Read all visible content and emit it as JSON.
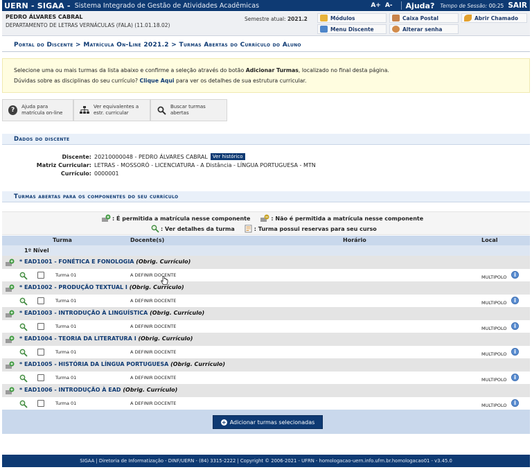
{
  "topbar": {
    "brand": "UERN - SIGAA -",
    "system": "Sistema Integrado de Gestão de Atividades Acadêmicas",
    "font_up": "A+",
    "font_down": "A-",
    "help": "Ajuda?",
    "session_label": "Tempo de Sessão:",
    "session_time": "00:25",
    "logout": "SAIR"
  },
  "user": {
    "name": "PEDRO ÁLVARES CABRAL",
    "department": "DEPARTAMENTO DE LETRAS VERNÁCULAS (FALA) (11.01.18.02)",
    "semester_label": "Semestre atual:",
    "semester": "2021.2"
  },
  "quick_links": {
    "modulos": "Módulos",
    "caixa_postal": "Caixa Postal",
    "abrir_chamado": "Abrir Chamado",
    "menu_discente": "Menu Discente",
    "alterar_senha": "Alterar senha"
  },
  "breadcrumb": "Portal do Discente > Matrícula On-Line 2021.2 > Turmas Abertas do Currículo do Aluno",
  "notice": {
    "line1_pre": "Selecione uma ou mais turmas da lista abaixo e confirme a seleção através do botão ",
    "line1_bold": "Adicionar Turmas",
    "line1_post": ", localizado no final desta página.",
    "line2_pre": "Dúvidas sobre as disciplinas do seu currículo? ",
    "line2_link": "Clique Aqui",
    "line2_post": " para ver os detalhes de sua estrutura curricular."
  },
  "actions": {
    "help": "Ajuda para matrícula on-line",
    "equivalents": "Ver equivalentes a estr. curricular",
    "search": "Buscar turmas abertas"
  },
  "dados": {
    "title": "Dados do discente",
    "discente_label": "Discente:",
    "discente_value": "20210000048 - PEDRO ÁLVARES CABRAL",
    "historico_btn": "Ver histórico",
    "matriz_label": "Matriz Curricular:",
    "matriz_value": "LETRAS - MOSSORÓ - LICENCIATURA - A Distância - LÍNGUA PORTUGUESA - MTN",
    "curriculo_label": "Currículo:",
    "curriculo_value": "0000001"
  },
  "turmas": {
    "title": "Turmas abertas para os componentes do seu currículo",
    "legend_allowed": ": É permitida a matrícula nesse componente",
    "legend_not_allowed": ": Não é permitida a matrícula nesse componente",
    "legend_details": ": Ver detalhes da turma",
    "legend_reserved": ": Turma possui reservas para seu curso",
    "columns": {
      "turma": "Turma",
      "docente": "Docente(s)",
      "horario": "Horário",
      "local": "Local"
    },
    "level": "1º Nível",
    "obrig": "(Obrig. Currículo)",
    "rows": [
      {
        "component": "* EAD1001 - FONÉTICA E FONOLOGIA",
        "turma": "Turma 01",
        "docente": "A DEFINIR DOCENTE",
        "local": "MULTIPOLO"
      },
      {
        "component": "* EAD1002 - PRODUÇÃO TEXTUAL I",
        "turma": "Turma 01",
        "docente": "A DEFINIR DOCENTE",
        "local": "MULTIPOLO"
      },
      {
        "component": "* EAD1003 - INTRODUÇÃO À LINGUÍSTICA",
        "turma": "Turma 01",
        "docente": "A DEFINIR DOCENTE",
        "local": "MULTIPOLO"
      },
      {
        "component": "* EAD1004 - TEORIA DA LITERATURA I",
        "turma": "Turma 01",
        "docente": "A DEFINIR DOCENTE",
        "local": "MULTIPOLO"
      },
      {
        "component": "* EAD1005 - HISTÓRIA DA LÍNGUA PORTUGUESA",
        "turma": "Turma 01",
        "docente": "A DEFINIR DOCENTE",
        "local": "MULTIPOLO"
      },
      {
        "component": "* EAD1006 - INTRODUÇÃO À EAD",
        "turma": "Turma 01",
        "docente": "A DEFINIR DOCENTE",
        "local": "MULTIPOLO"
      }
    ],
    "add_button": "Adicionar turmas selecionadas"
  },
  "footer": "SIGAA | Diretoria de Informatização - DINF/UERN - (84) 3315-2222 | Copyright © 2006-2021 - UFRN - homologacao-uern.info.ufrn.br.homologacao01 - v3.45.0",
  "colors": {
    "navy": "#0e3a73",
    "notice_bg": "#fffde0",
    "header_blue": "#c9d8ec"
  }
}
